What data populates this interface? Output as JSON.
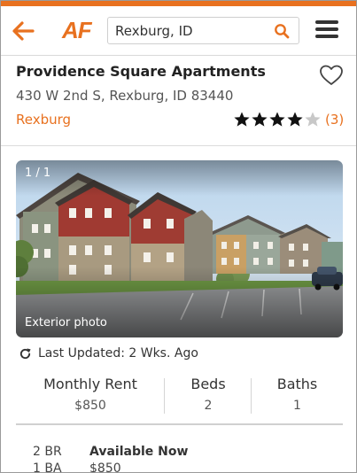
{
  "colors": {
    "accent": "#e8711f",
    "star_filled": "#111111",
    "star_empty": "#c8c8c8"
  },
  "header": {
    "back_icon": "arrow-left-icon",
    "logo_text": "AF",
    "search": {
      "value": "Rexburg, ID",
      "icon": "search-icon"
    },
    "menu_icon": "hamburger-menu-icon"
  },
  "listing": {
    "title": "Providence Square Apartments",
    "address": "430 W 2nd S, Rexburg, ID 83440",
    "city": "Rexburg",
    "rating": {
      "stars": 4,
      "max": 5,
      "count_text": "(3)"
    },
    "favorite_icon": "heart-outline-icon"
  },
  "photo": {
    "counter": "1 / 1",
    "caption": "Exterior photo"
  },
  "updated": {
    "icon": "refresh-icon",
    "text": "Last Updated: 2 Wks. Ago"
  },
  "stats": [
    {
      "label": "Monthly Rent",
      "value": "$850"
    },
    {
      "label": "Beds",
      "value": "2"
    },
    {
      "label": "Baths",
      "value": "1"
    }
  ],
  "unit": {
    "beds": "2 BR",
    "baths": "1 BA",
    "availability": "Available Now",
    "price": "$850"
  }
}
